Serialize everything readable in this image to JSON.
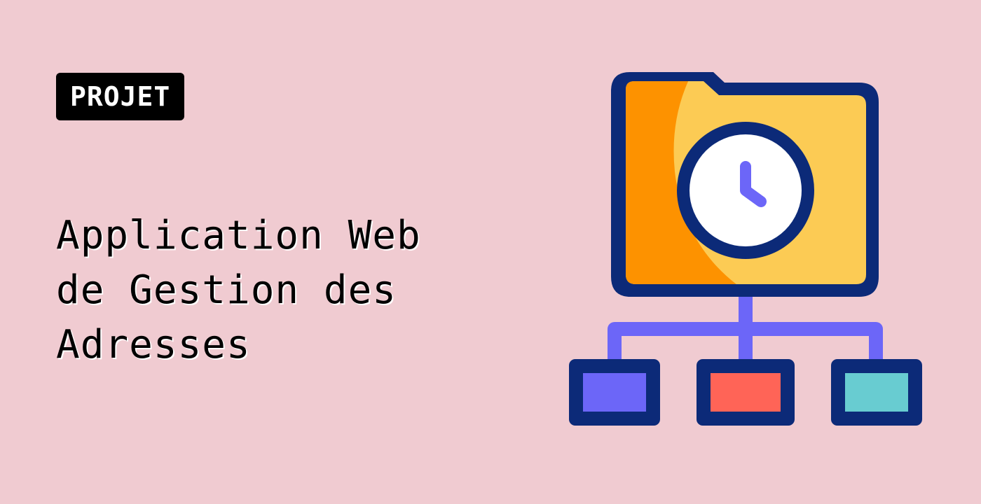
{
  "colors": {
    "background": "#f0cbd1",
    "badge_bg": "#000000",
    "badge_text": "#ffffff",
    "title_text": "#000000",
    "outline": "#0c2a78",
    "folder_front": "#fccb54",
    "folder_back": "#fd9200",
    "clock_face": "#ffffff",
    "clock_hands": "#6c66f8",
    "connector": "#6c66f8",
    "box_purple": "#6c66f8",
    "box_red": "#ff6457",
    "box_teal": "#68ccd1"
  },
  "badge": {
    "label": "PROJET"
  },
  "title": {
    "lines": [
      "Application Web",
      "de Gestion des",
      "Adresses"
    ]
  },
  "illustration": {
    "icons": [
      "folder-icon",
      "clock-icon",
      "hierarchy-icon"
    ]
  }
}
